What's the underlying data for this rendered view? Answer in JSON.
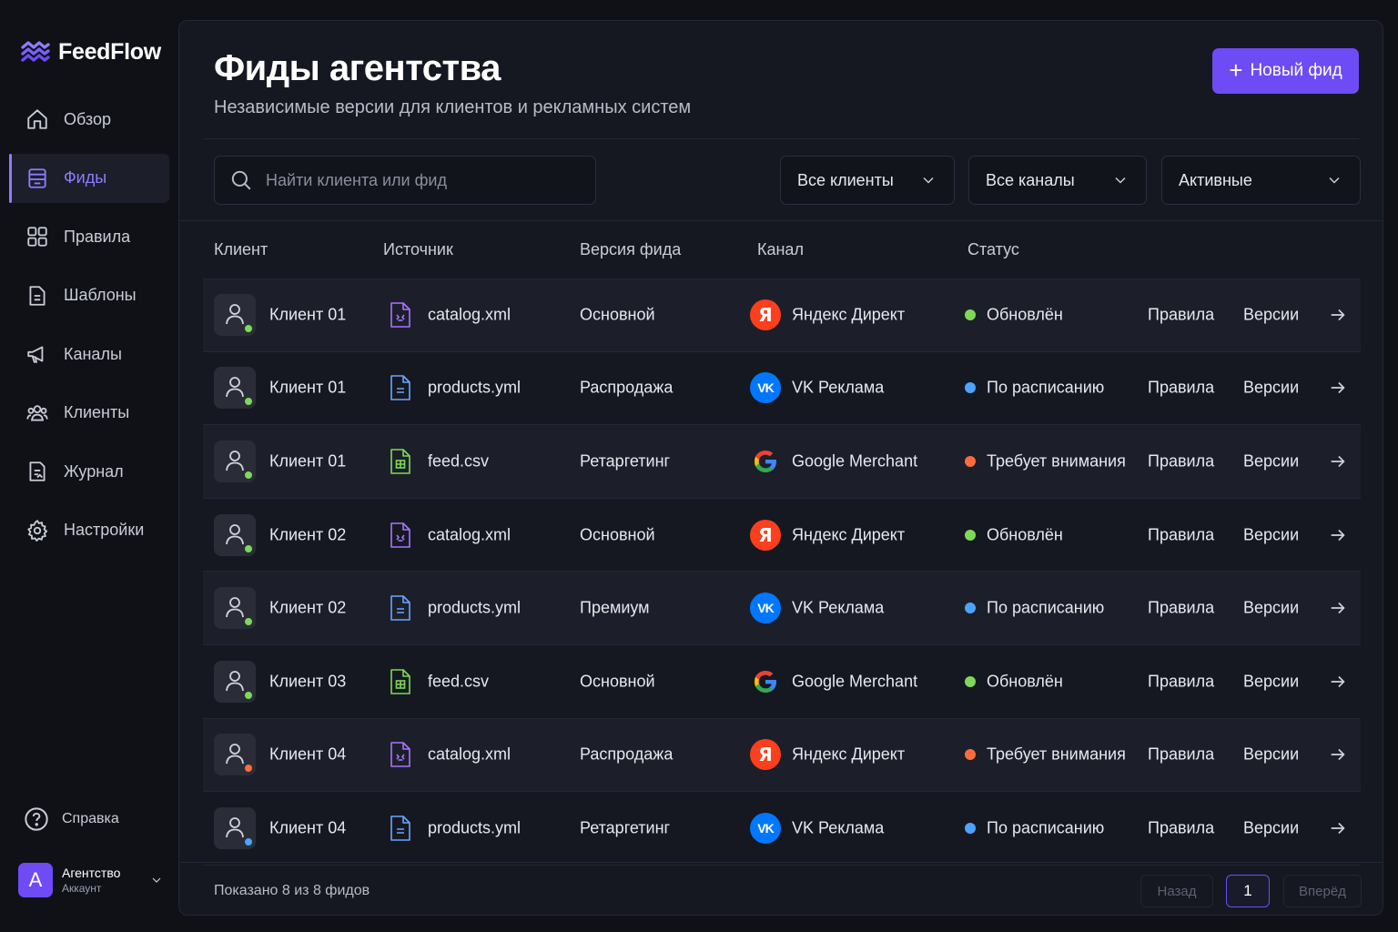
{
  "app": {
    "name": "FeedFlow",
    "brand_color": "#6d4cf5"
  },
  "sidebar": {
    "items": [
      {
        "label": "Обзор",
        "icon": "home-icon",
        "active": false
      },
      {
        "label": "Фиды",
        "icon": "feed-stack-icon",
        "active": true
      },
      {
        "label": "Правила",
        "icon": "grid-icon",
        "active": false
      },
      {
        "label": "Шаблоны",
        "icon": "document-icon",
        "active": false
      },
      {
        "label": "Каналы",
        "icon": "megaphone-icon",
        "active": false
      },
      {
        "label": "Клиенты",
        "icon": "users-icon",
        "active": false
      },
      {
        "label": "Журнал",
        "icon": "log-icon",
        "active": false
      },
      {
        "label": "Настройки",
        "icon": "gear-icon",
        "active": false
      }
    ],
    "help_label": "Справка",
    "account": {
      "initial": "A",
      "name": "Агентство",
      "sub": "Аккаунт"
    }
  },
  "header": {
    "title": "Фиды агентства",
    "subtitle": "Независимые версии для клиентов и рекламных систем",
    "new_button": "Новый фид"
  },
  "filters": {
    "search_placeholder": "Найти клиента или фид",
    "clients": "Все клиенты",
    "channels": "Все каналы",
    "status": "Активные"
  },
  "table": {
    "columns": [
      "Клиент",
      "Источник",
      "Версия фида",
      "Канал",
      "Статус"
    ],
    "action_rules": "Правила",
    "action_versions": "Версии",
    "rows": [
      {
        "client": "Клиент 01",
        "client_status": "green",
        "file": "catalog.xml",
        "file_type": "xml",
        "version": "Основной",
        "channel": "Яндекс Директ",
        "channel_type": "yandex",
        "status": "Обновлён",
        "status_color": "green"
      },
      {
        "client": "Клиент 01",
        "client_status": "green",
        "file": "products.yml",
        "file_type": "yml",
        "version": "Распродажа",
        "channel": "VK Реклама",
        "channel_type": "vk",
        "status": "По расписанию",
        "status_color": "blue"
      },
      {
        "client": "Клиент 01",
        "client_status": "green",
        "file": "feed.csv",
        "file_type": "csv",
        "version": "Ретаргетинг",
        "channel": "Google Merchant",
        "channel_type": "google",
        "status": "Требует внимания",
        "status_color": "orange"
      },
      {
        "client": "Клиент 02",
        "client_status": "green",
        "file": "catalog.xml",
        "file_type": "xml",
        "version": "Основной",
        "channel": "Яндекс Директ",
        "channel_type": "yandex",
        "status": "Обновлён",
        "status_color": "green"
      },
      {
        "client": "Клиент 02",
        "client_status": "green",
        "file": "products.yml",
        "file_type": "yml",
        "version": "Премиум",
        "channel": "VK Реклама",
        "channel_type": "vk",
        "status": "По расписанию",
        "status_color": "blue"
      },
      {
        "client": "Клиент 03",
        "client_status": "green",
        "file": "feed.csv",
        "file_type": "csv",
        "version": "Основной",
        "channel": "Google Merchant",
        "channel_type": "google",
        "status": "Обновлён",
        "status_color": "green"
      },
      {
        "client": "Клиент 04",
        "client_status": "orange",
        "file": "catalog.xml",
        "file_type": "xml",
        "version": "Распродажа",
        "channel": "Яндекс Директ",
        "channel_type": "yandex",
        "status": "Требует внимания",
        "status_color": "orange"
      },
      {
        "client": "Клиент 04",
        "client_status": "blue",
        "file": "products.yml",
        "file_type": "yml",
        "version": "Ретаргетинг",
        "channel": "VK Реклама",
        "channel_type": "vk",
        "status": "По расписанию",
        "status_color": "blue"
      }
    ]
  },
  "footer": {
    "summary": "Показано 8 из 8 фидов",
    "prev": "Назад",
    "current_page": "1",
    "next": "Вперёд"
  },
  "colors": {
    "green": "#7ed957",
    "blue": "#4da3ff",
    "orange": "#ff6b3d",
    "yandex": "#fc3f1d",
    "vk": "#0077ff",
    "xml_icon": "#a974ff",
    "yml_icon": "#6aa6ff",
    "csv_icon": "#7ed957"
  }
}
